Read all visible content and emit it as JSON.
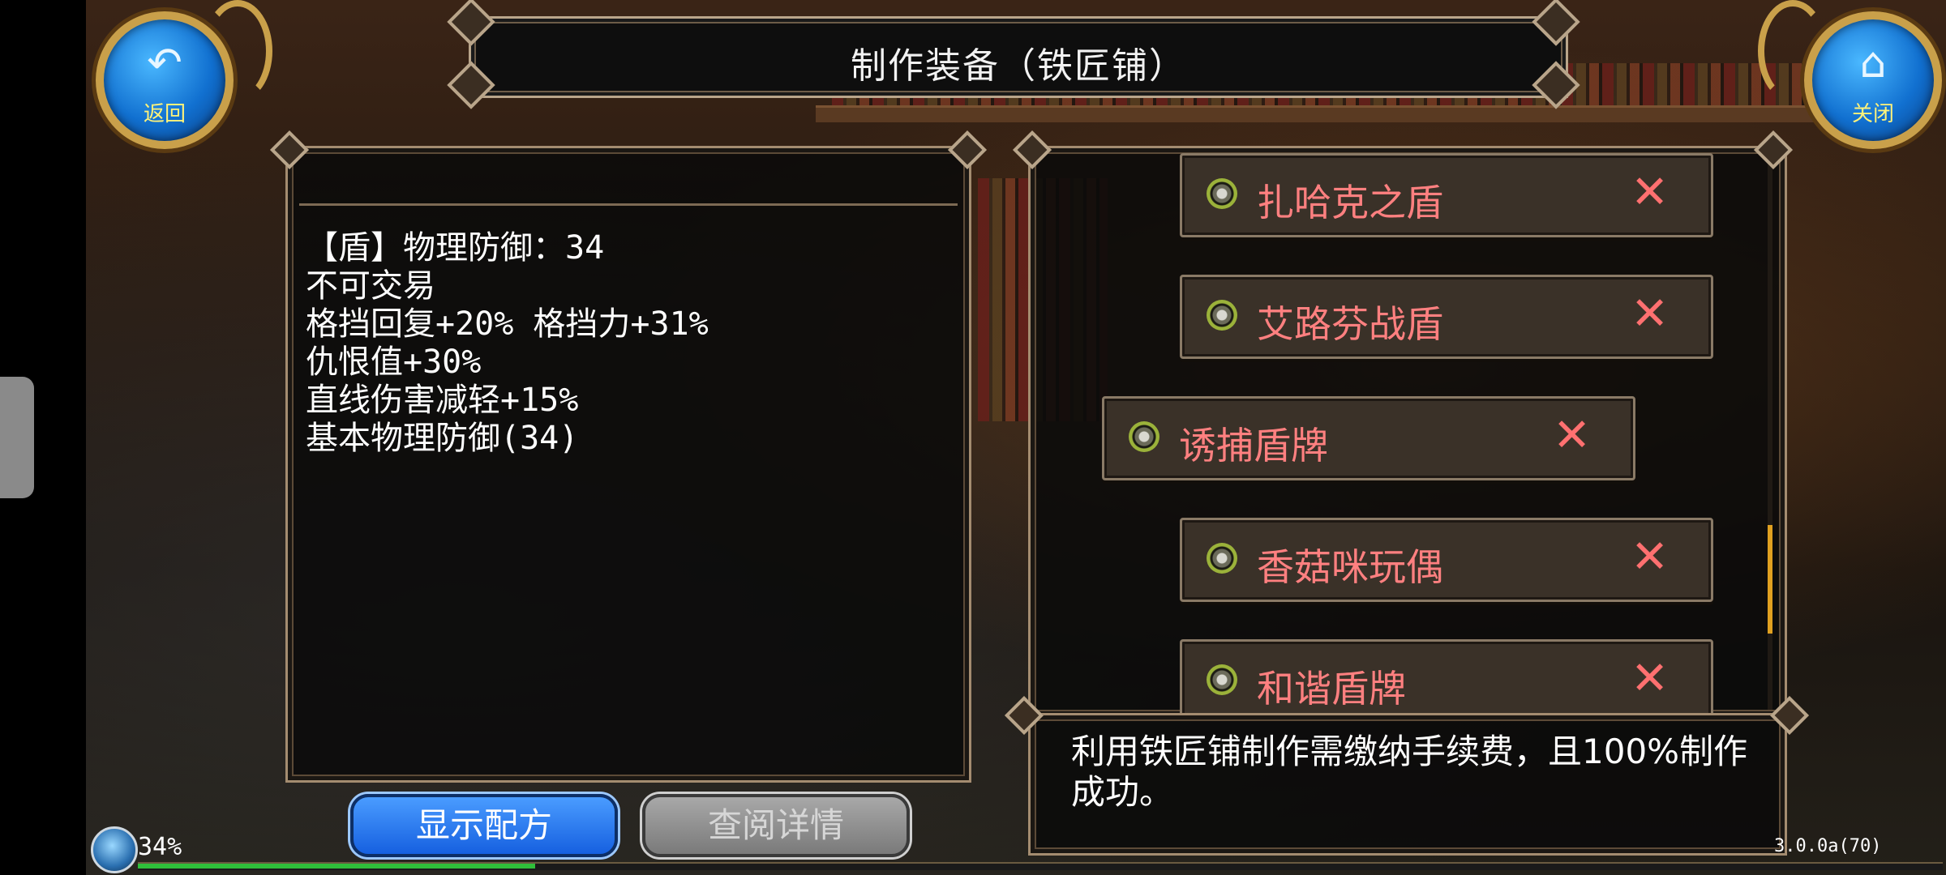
{
  "window": {
    "title": "制作装备（铁匠铺）"
  },
  "buttons": {
    "back": {
      "label": "返回",
      "icon": "return-arrow-icon"
    },
    "close": {
      "label": "关闭",
      "icon": "home-icon"
    },
    "show_recipe": "显示配方",
    "view_details": "查阅详情"
  },
  "item_details": {
    "lines": [
      "【盾】物理防御：34",
      "不可交易",
      "格挡回复+20% 格挡力+31%",
      "仇恨值+30%",
      "直线伤害减轻+15%",
      "基本物理防御(34)"
    ]
  },
  "recipe_list": {
    "items": [
      {
        "name": "扎哈克之盾",
        "icon": "shield-icon",
        "remove": "✕"
      },
      {
        "name": "艾路芬战盾",
        "icon": "shield-icon",
        "remove": "✕"
      },
      {
        "name": "诱捕盾牌",
        "icon": "shield-icon",
        "remove": "✕",
        "selected": true
      },
      {
        "name": "香菇咪玩偶",
        "icon": "shield-icon",
        "remove": "✕"
      },
      {
        "name": "和谐盾牌",
        "icon": "shield-icon",
        "remove": "✕"
      }
    ]
  },
  "info": {
    "text": "利用铁匠铺制作需缴纳手续费，且100%制作成功。"
  },
  "hud": {
    "percent": "34%",
    "exp_fraction": 0.22,
    "version": "3.0.0a(70)"
  },
  "colors": {
    "item_name": "#ff8080",
    "accent_blue": "#1660e0",
    "exp_green": "#2fbf3a",
    "scroll_thumb": "#e0a020"
  }
}
